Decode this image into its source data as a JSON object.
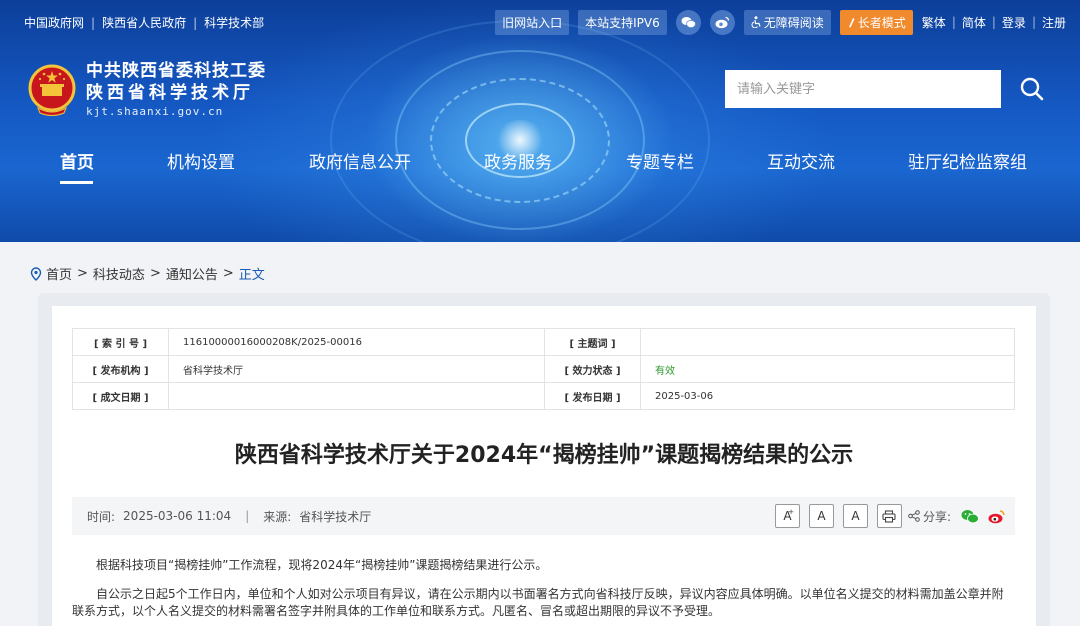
{
  "topbar": {
    "links": [
      "中国政府网",
      "陕西省人民政府",
      "科学技术部"
    ],
    "old_site": "旧网站入口",
    "ipv6": "本站支持IPV6",
    "accessible": "无障碍阅读",
    "elder_mode": "长者模式",
    "traditional": "繁体",
    "simplified": "简体",
    "login": "登录",
    "register": "注册"
  },
  "logo": {
    "line1": "中共陕西省委科技工委",
    "line2": "陕西省科学技术厅",
    "domain": "kjt.shaanxi.gov.cn"
  },
  "search": {
    "placeholder": "请输入关键字"
  },
  "nav": {
    "items": [
      "首页",
      "机构设置",
      "政府信息公开",
      "政务服务",
      "专题专栏",
      "互动交流",
      "驻厅纪检监察组"
    ],
    "active": "首页"
  },
  "breadcrumb": [
    "首页",
    "科技动态",
    "通知公告",
    "正文"
  ],
  "meta": {
    "index_label": "[ 索 引 号 ]",
    "index_value": "11610000016000208K/2025-00016",
    "subject_label": "[ 主题词 ]",
    "subject_value": "",
    "publisher_label": "[ 发布机构 ]",
    "publisher_value": "省科学技术厅",
    "validity_label": "[ 效力状态 ]",
    "validity_value": "有效",
    "created_label": "[ 成文日期 ]",
    "created_value": "",
    "published_label": "[ 发布日期 ]",
    "published_value": "2025-03-06"
  },
  "article": {
    "title": "陕西省科学技术厅关于2024年“揭榜挂帅”课题揭榜结果的公示",
    "time_label": "时间:",
    "time_value": "2025-03-06 11:04",
    "divider": "|",
    "source_label": "来源:",
    "source_value": "省科学技术厅",
    "share_label": "分享:",
    "paragraph1": "根据科技项目“揭榜挂帅”工作流程，现将2024年“揭榜挂帅”课题揭榜结果进行公示。",
    "paragraph2": "自公示之日起5个工作日内，单位和个人如对公示项目有异议，请在公示期内以书面署名方式向省科技厅反映，异议内容应具体明确。以单位名义提交的材料需加盖公章并附联系方式，以个人名义提交的材料需署名签字并附具体的工作单位和联系方式。凡匿名、冒名或超出期限的异议不予受理。"
  },
  "font_buttons": {
    "large": "A",
    "large_sup": "+",
    "medium": "A",
    "small": "A"
  },
  "colors": {
    "header_blue": "#1559c4",
    "elder_orange": "#f08a2c",
    "link_blue": "#1a5bb4",
    "valid_green": "#2e9a2e"
  }
}
